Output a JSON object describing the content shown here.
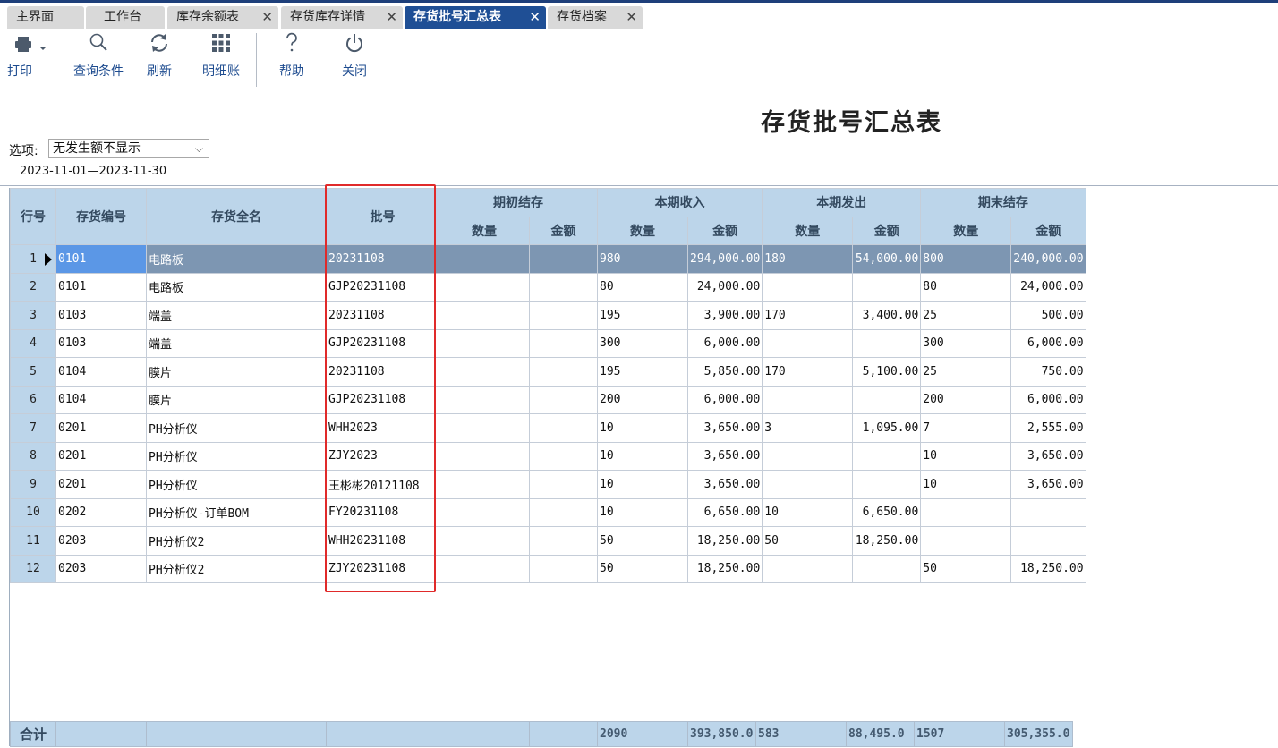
{
  "tabs": [
    {
      "label": "主界面",
      "closable": false,
      "active": false
    },
    {
      "label": "工作台",
      "closable": false,
      "active": false
    },
    {
      "label": "库存余额表",
      "closable": true,
      "active": false
    },
    {
      "label": "存货库存详情",
      "closable": true,
      "active": false
    },
    {
      "label": "存货批号汇总表",
      "closable": true,
      "active": true
    },
    {
      "label": "存货档案",
      "closable": true,
      "active": false
    }
  ],
  "tab_close_glyph": "✕",
  "toolbar": {
    "print": {
      "label": "打印",
      "icon": "printer-icon"
    },
    "query": {
      "label": "查询条件",
      "icon": "search-icon"
    },
    "refresh": {
      "label": "刷新",
      "icon": "refresh-icon"
    },
    "detail": {
      "label": "明细账",
      "icon": "grid-icon"
    },
    "help": {
      "label": "帮助",
      "icon": "help-icon"
    },
    "close": {
      "label": "关闭",
      "icon": "power-icon"
    }
  },
  "report": {
    "title": "存货批号汇总表",
    "option_label": "选项:",
    "option_value": "无发生额不显示",
    "date_range": "2023-11-01—2023-11-30"
  },
  "table": {
    "headers": {
      "row_no": "行号",
      "code": "存货编号",
      "name": "存货全名",
      "batch": "批号",
      "opening": "期初结存",
      "received": "本期收入",
      "issued": "本期发出",
      "closing": "期末结存",
      "qty": "数量",
      "amount": "金额"
    },
    "rows": [
      {
        "no": "1",
        "code": "0101",
        "name": "电路板",
        "batch": "20231108",
        "oq": "",
        "oa": "",
        "rq": "980",
        "ra": "294,000.00",
        "iq": "180",
        "ia": "54,000.00",
        "cq": "800",
        "ca": "240,000.00"
      },
      {
        "no": "2",
        "code": "0101",
        "name": "电路板",
        "batch": "GJP20231108",
        "oq": "",
        "oa": "",
        "rq": "80",
        "ra": "24,000.00",
        "iq": "",
        "ia": "",
        "cq": "80",
        "ca": "24,000.00"
      },
      {
        "no": "3",
        "code": "0103",
        "name": "端盖",
        "batch": "20231108",
        "oq": "",
        "oa": "",
        "rq": "195",
        "ra": "3,900.00",
        "iq": "170",
        "ia": "3,400.00",
        "cq": "25",
        "ca": "500.00"
      },
      {
        "no": "4",
        "code": "0103",
        "name": "端盖",
        "batch": "GJP20231108",
        "oq": "",
        "oa": "",
        "rq": "300",
        "ra": "6,000.00",
        "iq": "",
        "ia": "",
        "cq": "300",
        "ca": "6,000.00"
      },
      {
        "no": "5",
        "code": "0104",
        "name": "膜片",
        "batch": "20231108",
        "oq": "",
        "oa": "",
        "rq": "195",
        "ra": "5,850.00",
        "iq": "170",
        "ia": "5,100.00",
        "cq": "25",
        "ca": "750.00"
      },
      {
        "no": "6",
        "code": "0104",
        "name": "膜片",
        "batch": "GJP20231108",
        "oq": "",
        "oa": "",
        "rq": "200",
        "ra": "6,000.00",
        "iq": "",
        "ia": "",
        "cq": "200",
        "ca": "6,000.00"
      },
      {
        "no": "7",
        "code": "0201",
        "name": "PH分析仪",
        "batch": "WHH2023",
        "oq": "",
        "oa": "",
        "rq": "10",
        "ra": "3,650.00",
        "iq": "3",
        "ia": "1,095.00",
        "cq": "7",
        "ca": "2,555.00"
      },
      {
        "no": "8",
        "code": "0201",
        "name": "PH分析仪",
        "batch": "ZJY2023",
        "oq": "",
        "oa": "",
        "rq": "10",
        "ra": "3,650.00",
        "iq": "",
        "ia": "",
        "cq": "10",
        "ca": "3,650.00"
      },
      {
        "no": "9",
        "code": "0201",
        "name": "PH分析仪",
        "batch": "王彬彬20121108",
        "oq": "",
        "oa": "",
        "rq": "10",
        "ra": "3,650.00",
        "iq": "",
        "ia": "",
        "cq": "10",
        "ca": "3,650.00"
      },
      {
        "no": "10",
        "code": "0202",
        "name": "PH分析仪-订单BOM",
        "batch": "FY20231108",
        "oq": "",
        "oa": "",
        "rq": "10",
        "ra": "6,650.00",
        "iq": "10",
        "ia": "6,650.00",
        "cq": "",
        "ca": ""
      },
      {
        "no": "11",
        "code": "0203",
        "name": "PH分析仪2",
        "batch": "WHH20231108",
        "oq": "",
        "oa": "",
        "rq": "50",
        "ra": "18,250.00",
        "iq": "50",
        "ia": "18,250.00",
        "cq": "",
        "ca": ""
      },
      {
        "no": "12",
        "code": "0203",
        "name": "PH分析仪2",
        "batch": "ZJY20231108",
        "oq": "",
        "oa": "",
        "rq": "50",
        "ra": "18,250.00",
        "iq": "",
        "ia": "",
        "cq": "50",
        "ca": "18,250.00"
      }
    ],
    "selected_row": 1,
    "totals": {
      "label": "合计",
      "rq": "2090",
      "ra": "393,850.0",
      "iq": "583",
      "ia": "88,495.0",
      "cq": "1507",
      "ca": "305,355.0"
    }
  }
}
